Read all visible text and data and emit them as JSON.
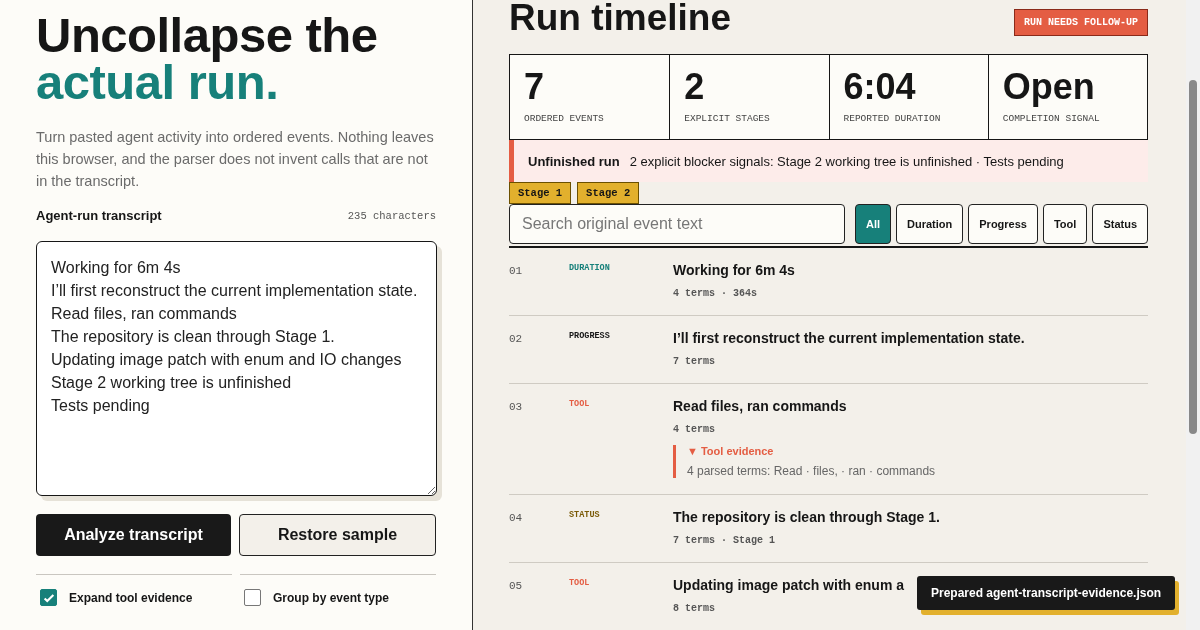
{
  "intro": {
    "title_line_1": "Uncollapse the",
    "title_line_2": "actual run.",
    "description": "Turn pasted agent activity into ordered events. Nothing leaves this browser, and the parser does not invent calls that are not in the transcript."
  },
  "transcript": {
    "label": "Agent-run transcript",
    "count": "235 characters",
    "value": "Working for 6m 4s\nI’ll first reconstruct the current implementation state.\nRead files, ran commands\nThe repository is clean through Stage 1.\nUpdating image patch with enum and IO changes\nStage 2 working tree is unfinished\nTests pending"
  },
  "buttons": [
    {
      "label": "Analyze transcript",
      "kind": "primary"
    },
    {
      "label": "Restore sample",
      "kind": "secondary"
    }
  ],
  "options": [
    {
      "label": "Expand tool evidence",
      "checked": true
    },
    {
      "label": "Group by event type",
      "checked": false
    }
  ],
  "timeline": {
    "title": "Run timeline",
    "badge": "RUN NEEDS FOLLOW-UP",
    "stats": [
      {
        "value": "7",
        "label": "ORDERED EVENTS"
      },
      {
        "value": "2",
        "label": "EXPLICIT STAGES"
      },
      {
        "value": "6:04",
        "label": "REPORTED DURATION"
      },
      {
        "value": "Open",
        "label": "COMPLETION SIGNAL"
      }
    ],
    "alert": {
      "title": "Unfinished run",
      "text": "2 explicit blocker signals: Stage 2 working tree is unfinished · Tests pending"
    },
    "stages": [
      "Stage 1",
      "Stage 2"
    ],
    "search": {
      "placeholder": "Search original event text"
    },
    "filters": [
      {
        "label": "All",
        "selected": true
      },
      {
        "label": "Duration",
        "selected": false
      },
      {
        "label": "Progress",
        "selected": false
      },
      {
        "label": "Tool",
        "selected": false
      },
      {
        "label": "Status",
        "selected": false
      }
    ],
    "events": [
      {
        "number": "01",
        "kind": "duration",
        "type": "DURATION",
        "title": "Working for 6m 4s",
        "meta": "4 terms · 364s"
      },
      {
        "number": "02",
        "kind": "progress",
        "type": "PROGRESS",
        "title": "I’ll first reconstruct the current implementation state.",
        "meta": "7 terms"
      },
      {
        "number": "03",
        "kind": "tool",
        "type": "TOOL",
        "title": "Read files, ran commands",
        "meta": "4 terms",
        "evidence": {
          "toggle": "▼",
          "title": "Tool evidence",
          "text": "4 parsed terms: Read · files, · ran · commands"
        }
      },
      {
        "number": "04",
        "kind": "status",
        "type": "STATUS",
        "title": "The repository is clean through Stage 1.",
        "meta": "7 terms · Stage 1"
      },
      {
        "number": "05",
        "kind": "tool",
        "type": "TOOL",
        "title": "Updating image patch with enum a",
        "meta": "8 terms"
      }
    ]
  },
  "toast": "Prepared agent-transcript-evidence.json"
}
